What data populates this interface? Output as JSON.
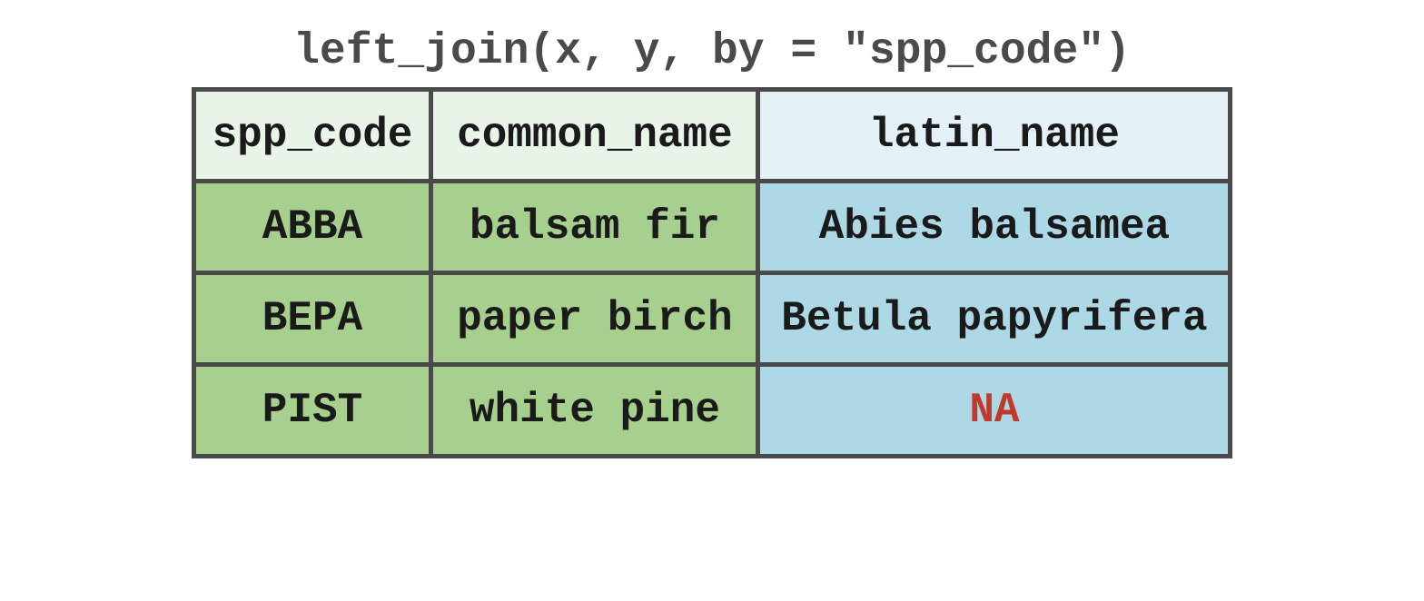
{
  "title": "left_join(x, y, by = \"spp_code\")",
  "headers": {
    "col1": "spp_code",
    "col2": "common_name",
    "col3": "latin_name"
  },
  "rows": [
    {
      "spp_code": "ABBA",
      "common_name": "balsam fir",
      "latin_name": "Abies balsamea",
      "is_na": false
    },
    {
      "spp_code": "BEPA",
      "common_name": "paper birch",
      "latin_name": "Betula papyrifera",
      "is_na": false
    },
    {
      "spp_code": "PIST",
      "common_name": "white pine",
      "latin_name": "NA",
      "is_na": true
    }
  ]
}
